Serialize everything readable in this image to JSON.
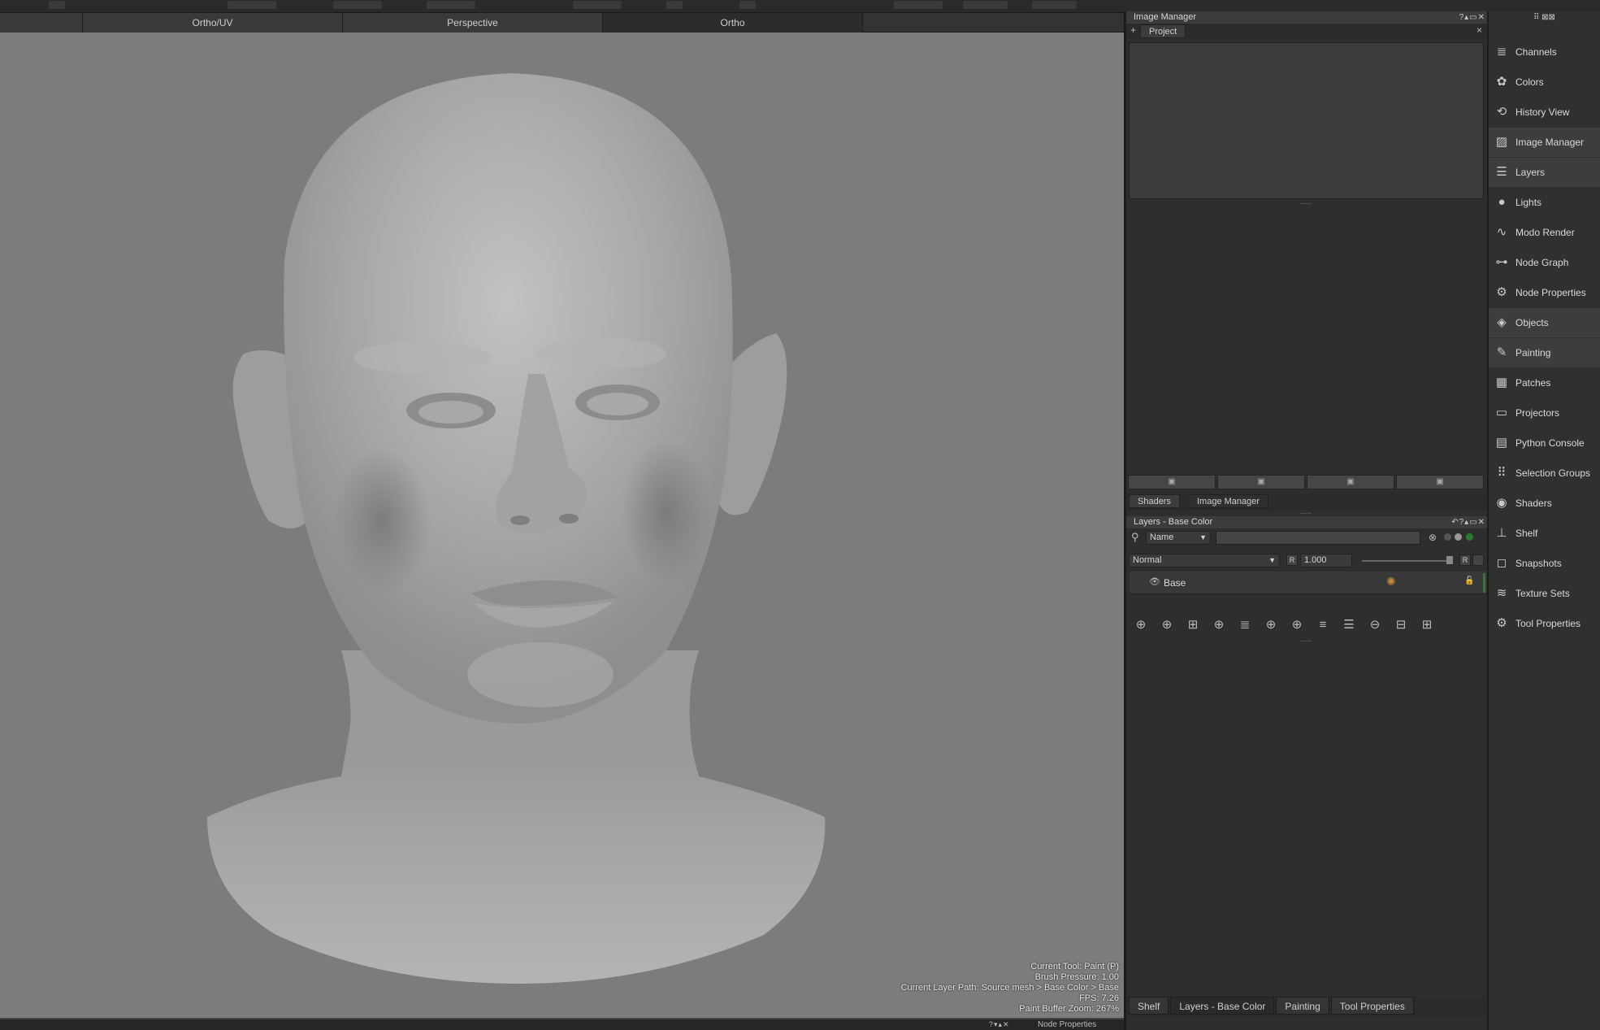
{
  "view_tabs": [
    "Ortho/UV",
    "Perspective",
    "Ortho"
  ],
  "hud": {
    "line1": "Current Tool: Paint (P)",
    "line2": "Brush Pressure: 1.00",
    "line3": "Current Layer Path: Source mesh > Base Color > Base",
    "line4": "FPS: 7.26",
    "line5": "Paint Buffer Zoom: 267%"
  },
  "bottom_panel": {
    "title": "Node Properties",
    "controls": "?▾▴✕"
  },
  "image_manager": {
    "title": "Image Manager",
    "controls": "?▴▭✕",
    "add_tab": "+",
    "project_tab": "Project",
    "close": "×",
    "grip": "......",
    "buttons": [
      "▣",
      "▣",
      "▣",
      "▣"
    ]
  },
  "midtabs": [
    "Shaders",
    "Image Manager"
  ],
  "layers": {
    "title": "Layers - Base Color",
    "controls": "↶?▴▭✕",
    "search_placeholder": "",
    "filter_value": "Name",
    "blend_mode": "Normal",
    "opacity": "1.000",
    "r_label": "R",
    "layer_name": "Base",
    "grip": "......",
    "toolbar_icons": [
      "⊕",
      "⊕",
      "⊞",
      "⊕",
      "≣",
      "⊕",
      "⊕",
      "≡",
      "☰",
      "⊖",
      "⊟",
      "⊞"
    ]
  },
  "bottom_tabs": [
    "Shelf",
    "Layers - Base Color",
    "Painting",
    "Tool Properties"
  ],
  "sidebar": {
    "top_controls": "⠿ ⊠⊠",
    "items": [
      {
        "label": "Channels",
        "icon": "≣"
      },
      {
        "label": "Colors",
        "icon": "✿"
      },
      {
        "label": "History View",
        "icon": "⟲"
      },
      {
        "label": "Image Manager",
        "icon": "▨"
      },
      {
        "label": "Layers",
        "icon": "☰"
      },
      {
        "label": "Lights",
        "icon": "●"
      },
      {
        "label": "Modo Render",
        "icon": "∿"
      },
      {
        "label": "Node Graph",
        "icon": "⊶"
      },
      {
        "label": "Node Properties",
        "icon": "⚙"
      },
      {
        "label": "Objects",
        "icon": "◈"
      },
      {
        "label": "Painting",
        "icon": "✎"
      },
      {
        "label": "Patches",
        "icon": "▦"
      },
      {
        "label": "Projectors",
        "icon": "▭"
      },
      {
        "label": "Python Console",
        "icon": "▤"
      },
      {
        "label": "Selection Groups",
        "icon": "⠿"
      },
      {
        "label": "Shaders",
        "icon": "◉"
      },
      {
        "label": "Shelf",
        "icon": "⊥"
      },
      {
        "label": "Snapshots",
        "icon": "◻"
      },
      {
        "label": "Texture Sets",
        "icon": "≋"
      },
      {
        "label": "Tool Properties",
        "icon": "⚙"
      }
    ]
  }
}
